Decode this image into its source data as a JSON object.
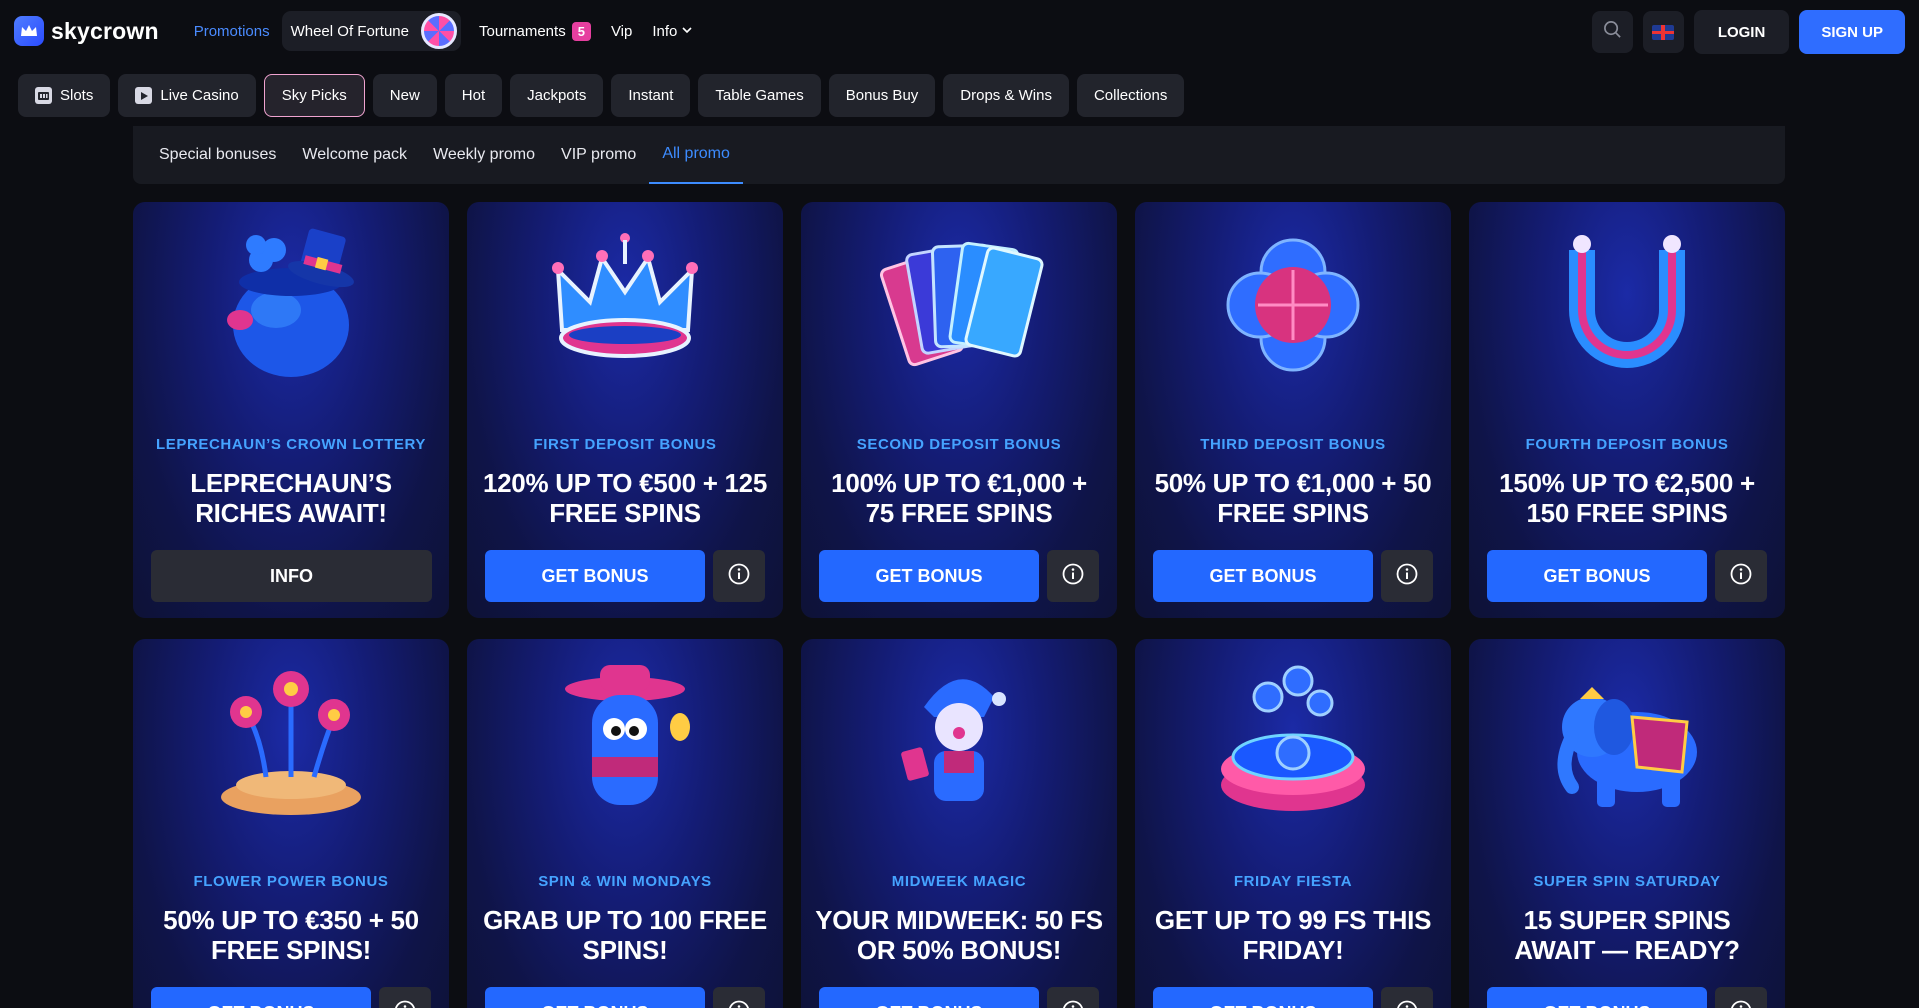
{
  "header": {
    "brand": "skycrown",
    "nav": {
      "promotions": "Promotions",
      "wheel_of_fortune": "Wheel Of Fortune",
      "tournaments": "Tournaments",
      "tournaments_count": "5",
      "vip": "Vip",
      "info": "Info"
    },
    "login": "LOGIN",
    "signup": "SIGN UP"
  },
  "categories": [
    "Slots",
    "Live Casino",
    "Sky Picks",
    "New",
    "Hot",
    "Jackpots",
    "Instant",
    "Table Games",
    "Bonus Buy",
    "Drops & Wins",
    "Collections"
  ],
  "promo_tabs": [
    "Special bonuses",
    "Welcome pack",
    "Weekly promo",
    "VIP promo",
    "All promo"
  ],
  "cards": [
    {
      "subtitle": "LEPRECHAUN’S CROWN LOTTERY",
      "title": "LEPRECHAUN’S RICHES AWAIT!",
      "button": "INFO",
      "art": "pot-with-hat"
    },
    {
      "subtitle": "FIRST DEPOSIT BONUS",
      "title": "120% UP TO €500 + 125 FREE SPINS",
      "button": "GET BONUS",
      "art": "crown"
    },
    {
      "subtitle": "SECOND DEPOSIT BONUS",
      "title": "100% UP TO €1,000 + 75 FREE SPINS",
      "button": "GET BONUS",
      "art": "playing-cards"
    },
    {
      "subtitle": "THIRD DEPOSIT BONUS",
      "title": "50% UP TO €1,000 + 50 FREE SPINS",
      "button": "GET BONUS",
      "art": "four-leaf-clover"
    },
    {
      "subtitle": "FOURTH DEPOSIT BONUS",
      "title": "150% UP TO €2,500 + 150 FREE SPINS",
      "button": "GET BONUS",
      "art": "horseshoe"
    },
    {
      "subtitle": "FLOWER POWER BONUS",
      "title": "50% UP TO €350 + 50 FREE SPINS!",
      "button": "GET BONUS",
      "art": "flowers-coins"
    },
    {
      "subtitle": "SPIN & WIN MONDAYS",
      "title": "GRAB UP TO 100 FREE SPINS!",
      "button": "GET BONUS",
      "art": "cowboy-character"
    },
    {
      "subtitle": "MIDWEEK MAGIC",
      "title": "YOUR MIDWEEK: 50 FS OR 50% BONUS!",
      "button": "GET BONUS",
      "art": "jester-character"
    },
    {
      "subtitle": "FRIDAY FIESTA",
      "title": "GET UP TO 99 FS THIS FRIDAY!",
      "button": "GET BONUS",
      "art": "coin-button"
    },
    {
      "subtitle": "SUPER SPIN SATURDAY",
      "title": "15 SUPER SPINS AWAIT — READY?",
      "button": "GET BONUS",
      "art": "elephant"
    }
  ],
  "colors": {
    "accent": "#2f6dff",
    "subtitle": "#45a3ff",
    "active_tab": "#3d8cff",
    "badge": "#e63f9f",
    "background": "#0c0d12"
  }
}
